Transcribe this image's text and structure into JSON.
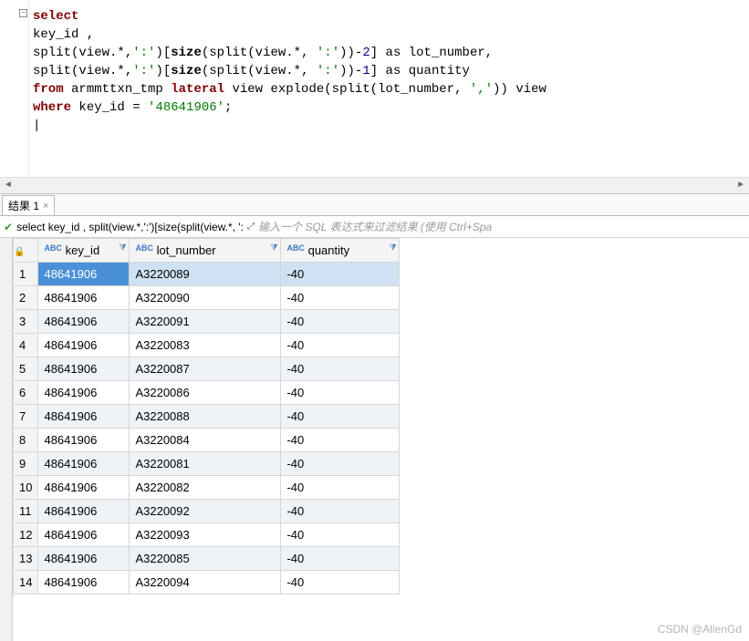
{
  "sql": {
    "line1_select": "select",
    "line2": "key_id ,",
    "line3": {
      "pre": "split(view.*,",
      "s1": "':'",
      "mid": ")[",
      "fn": "size",
      "p": "(split(view.*, ",
      "s2": "':'",
      "post": "))-",
      "n": "2",
      "end": "] as lot_number,"
    },
    "line4": {
      "pre": "split(view.*,",
      "s1": "':'",
      "mid": ")[",
      "fn": "size",
      "p": "(split(view.*, ",
      "s2": "':'",
      "post": "))-",
      "n": "1",
      "end": "] as quantity"
    },
    "line5": {
      "kw1": "from",
      "mid": " armmttxn_tmp ",
      "kw2": "lateral",
      "mid2": " view explode(split(lot_number, ",
      "s": "','",
      "end": ")) view"
    },
    "line6": {
      "kw": "where",
      "mid": " key_id = ",
      "s": "'48641906'",
      "end": ";"
    }
  },
  "tab": {
    "label": "结果 1",
    "close": "×"
  },
  "filter": {
    "queryText": "select key_id , split(view.*,':')[size(split(view.*, ':",
    "placeholder": "输入一个 SQL 表达式来过滤结果 (使用 Ctrl+Spa"
  },
  "columns": {
    "key_id": "key_id",
    "lot_number": "lot_number",
    "quantity": "quantity"
  },
  "rows": [
    {
      "key_id": "48641906",
      "lot_number": "A3220089",
      "quantity": "-40"
    },
    {
      "key_id": "48641906",
      "lot_number": "A3220090",
      "quantity": "-40"
    },
    {
      "key_id": "48641906",
      "lot_number": "A3220091",
      "quantity": "-40"
    },
    {
      "key_id": "48641906",
      "lot_number": "A3220083",
      "quantity": "-40"
    },
    {
      "key_id": "48641906",
      "lot_number": "A3220087",
      "quantity": "-40"
    },
    {
      "key_id": "48641906",
      "lot_number": "A3220086",
      "quantity": "-40"
    },
    {
      "key_id": "48641906",
      "lot_number": "A3220088",
      "quantity": "-40"
    },
    {
      "key_id": "48641906",
      "lot_number": "A3220084",
      "quantity": "-40"
    },
    {
      "key_id": "48641906",
      "lot_number": "A3220081",
      "quantity": "-40"
    },
    {
      "key_id": "48641906",
      "lot_number": "A3220082",
      "quantity": "-40"
    },
    {
      "key_id": "48641906",
      "lot_number": "A3220092",
      "quantity": "-40"
    },
    {
      "key_id": "48641906",
      "lot_number": "A3220093",
      "quantity": "-40"
    },
    {
      "key_id": "48641906",
      "lot_number": "A3220085",
      "quantity": "-40"
    },
    {
      "key_id": "48641906",
      "lot_number": "A3220094",
      "quantity": "-40"
    }
  ],
  "watermark": "CSDN @AllenGd"
}
